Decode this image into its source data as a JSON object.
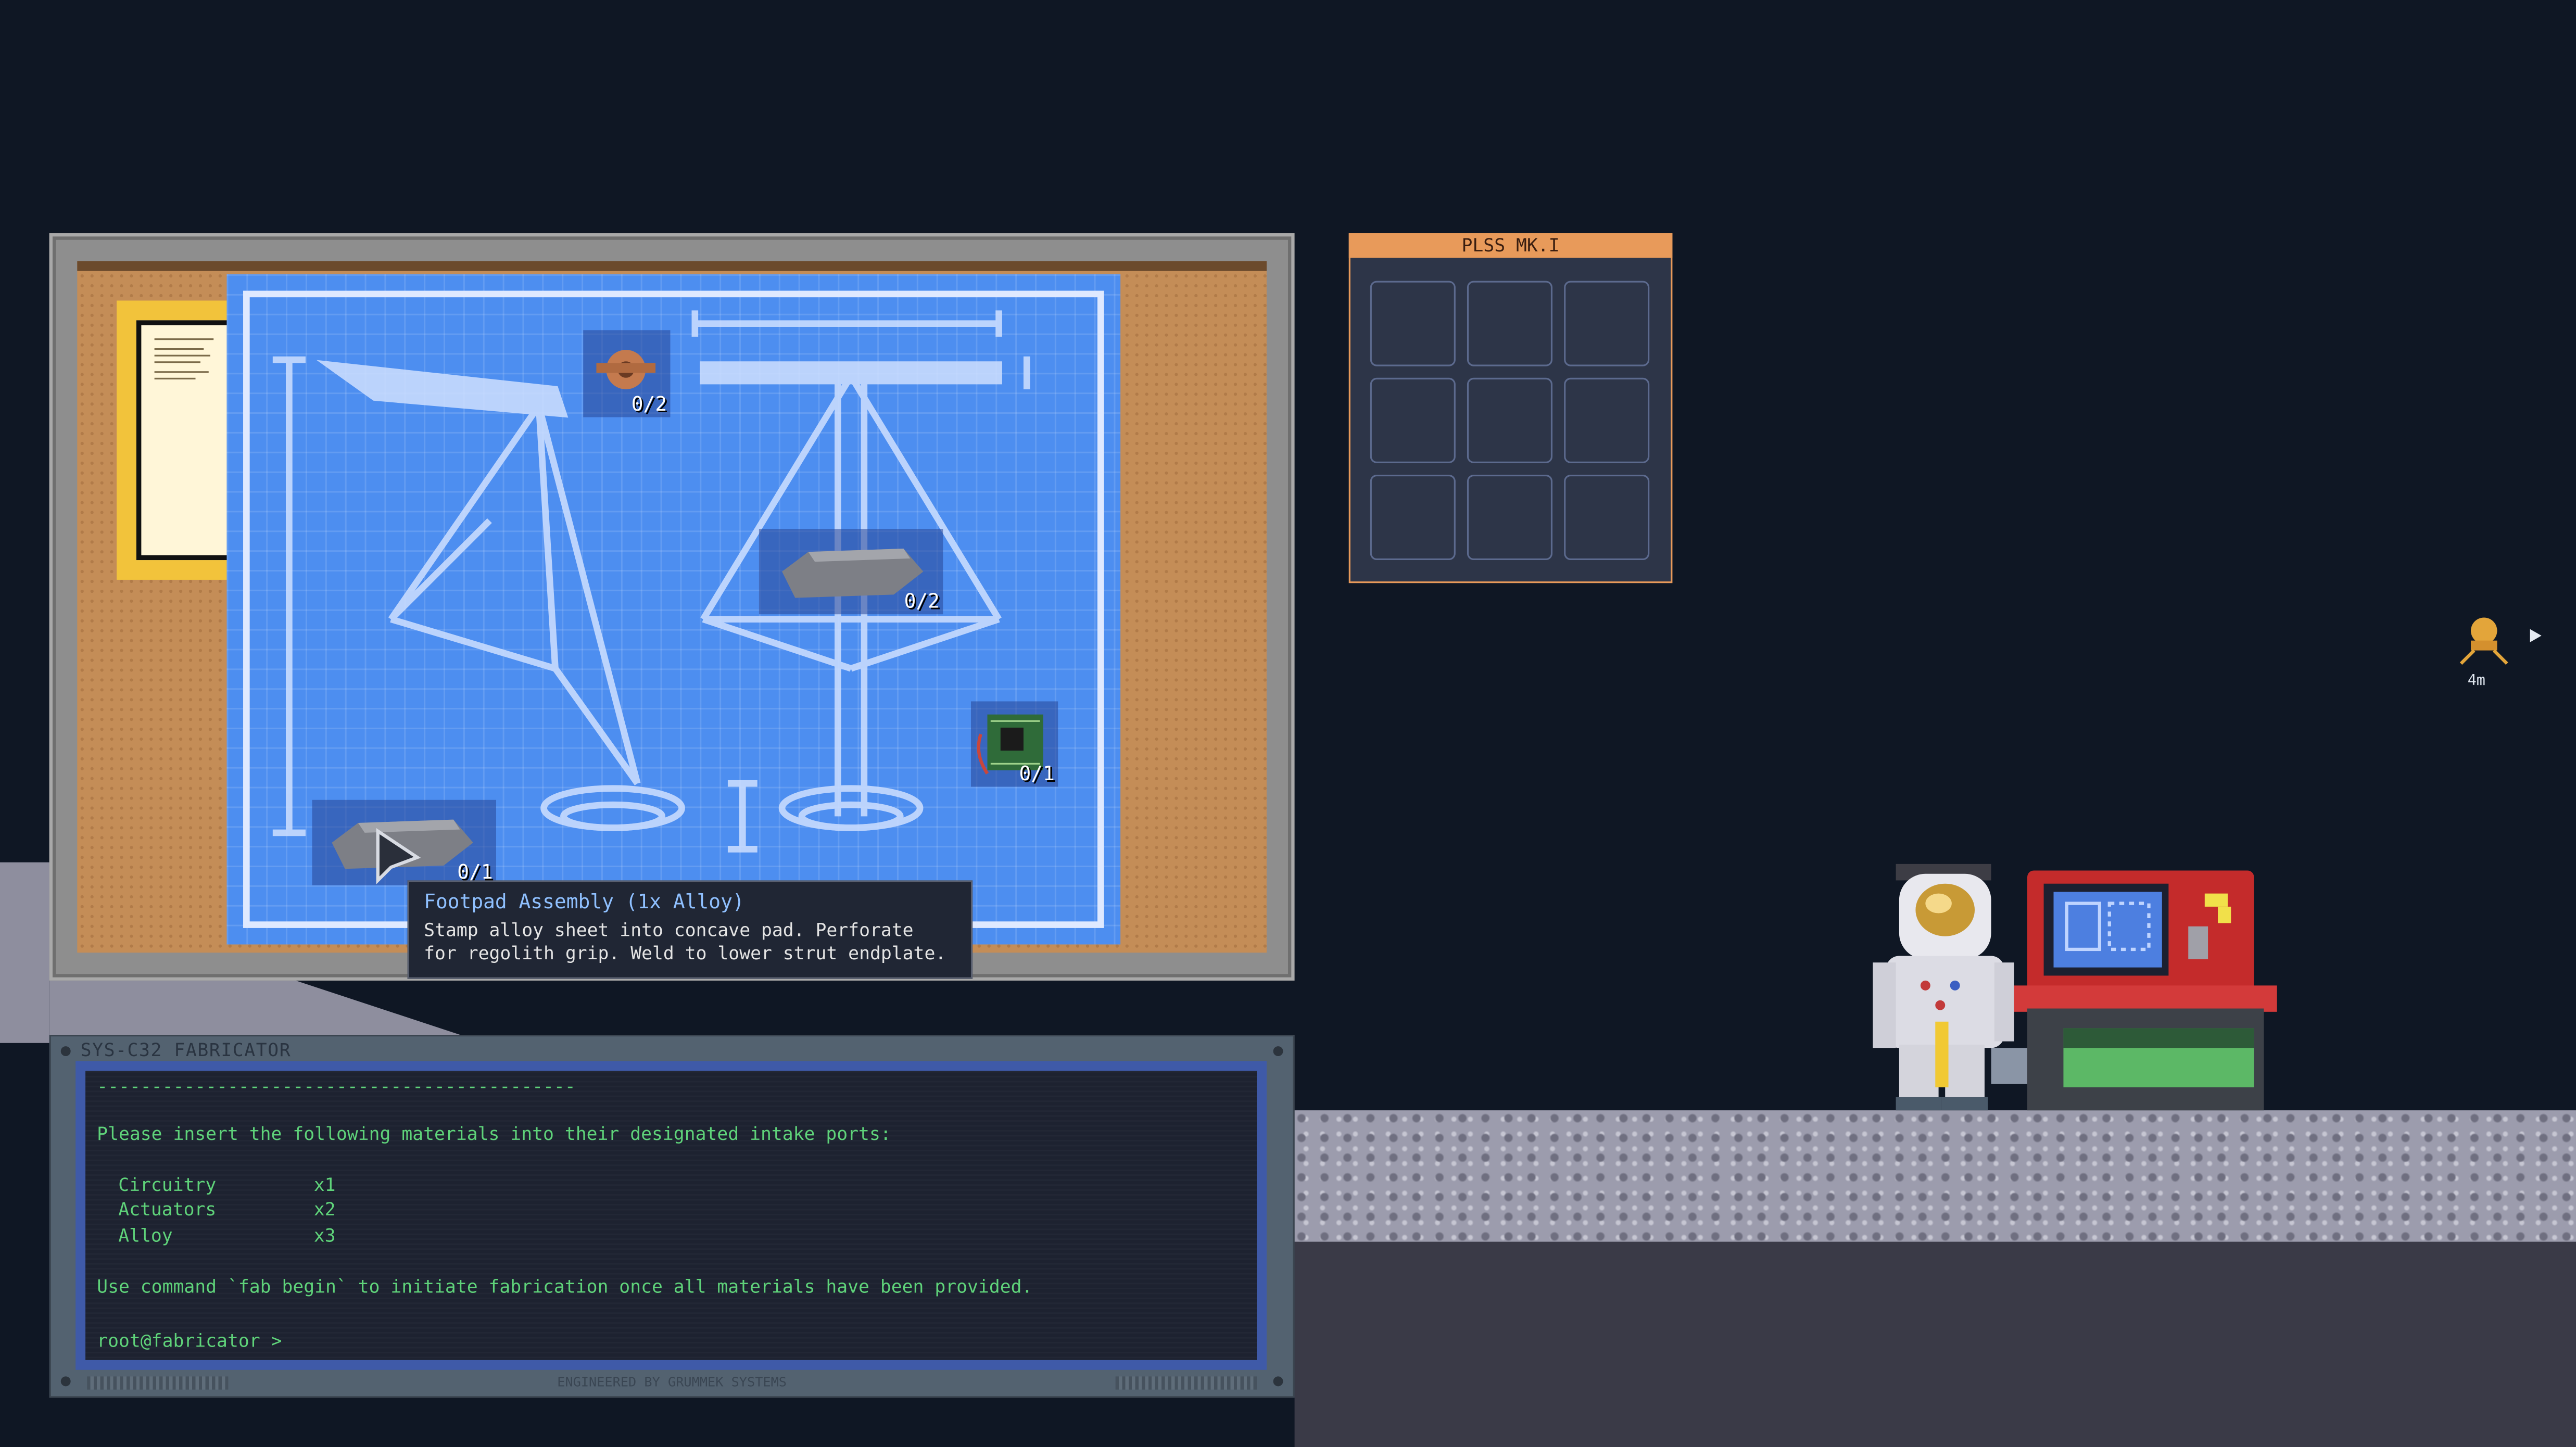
{
  "inventory": {
    "title": "PLSS MK.I",
    "slots": [
      "",
      "",
      "",
      "",
      "",
      "",
      "",
      "",
      ""
    ]
  },
  "blueprint": {
    "slots": [
      {
        "item": "actuator",
        "count": "0/2",
        "icon": "actuator-icon"
      },
      {
        "item": "alloy",
        "count": "0/2",
        "icon": "alloy-icon"
      },
      {
        "item": "circuitry",
        "count": "0/1",
        "icon": "circuit-board-icon"
      },
      {
        "item": "alloy",
        "count": "0/1",
        "icon": "alloy-icon"
      }
    ]
  },
  "tooltip": {
    "title": "Footpad Assembly (1x Alloy)",
    "body": "Stamp alloy sheet into concave pad. Perforate\nfor regolith grip. Weld to lower strut endplate."
  },
  "terminal": {
    "title": "SYS-C32 FABRICATOR",
    "separator": "--------------------------------------------",
    "intro": "Please insert the following materials into their designated intake ports:",
    "materials": [
      {
        "name": "Circuitry",
        "qty": "x1"
      },
      {
        "name": "Actuators",
        "qty": "x2"
      },
      {
        "name": "Alloy",
        "qty": "x3"
      }
    ],
    "instruction": "Use command `fab begin` to initiate fabrication once all materials have been provided.",
    "prompt": "root@fabricator >",
    "footer": "ENGINEERED BY GRUMMEK SYSTEMS"
  },
  "locator": {
    "distance": "4m",
    "icon": "lander-icon"
  },
  "colors": {
    "background": "#0f1724",
    "blueprint": "#4d8ef0",
    "terminal_text": "#5fd37a",
    "inventory_header": "#e89a5a"
  }
}
